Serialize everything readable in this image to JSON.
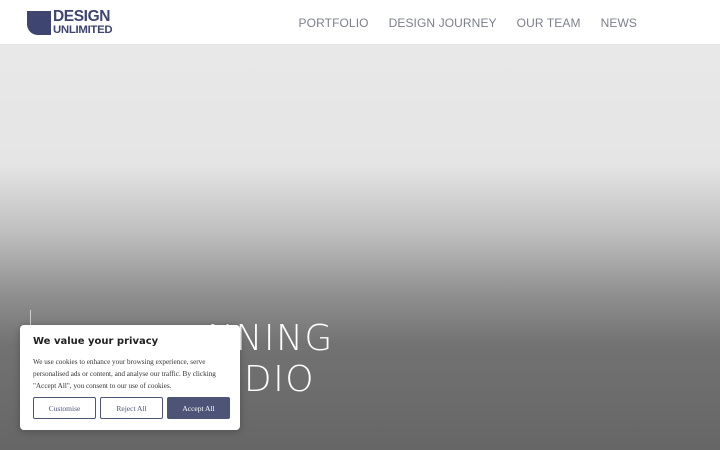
{
  "brand": {
    "line1": "DESIGN",
    "line2": "UNLIMITED",
    "color": "#3e4570"
  },
  "nav": {
    "items": [
      {
        "label": "PORTFOLIO"
      },
      {
        "label": "DESIGN JOURNEY"
      },
      {
        "label": "OUR TEAM"
      },
      {
        "label": "NEWS"
      }
    ]
  },
  "hero": {
    "line1": "NNING",
    "line2": "UDIO"
  },
  "cookie_banner": {
    "title": "We value your privacy",
    "body": "We use cookies to enhance your browsing experience, serve personalised ads or content, and analyse our traffic. By clicking \"Accept All\", you consent to our use of cookies.",
    "buttons": {
      "customise": "Customise",
      "reject": "Reject All",
      "accept": "Accept All"
    },
    "accent_color": "#4d5478"
  },
  "icons": {
    "logo_mark": "half-circle-square-logo-icon"
  }
}
